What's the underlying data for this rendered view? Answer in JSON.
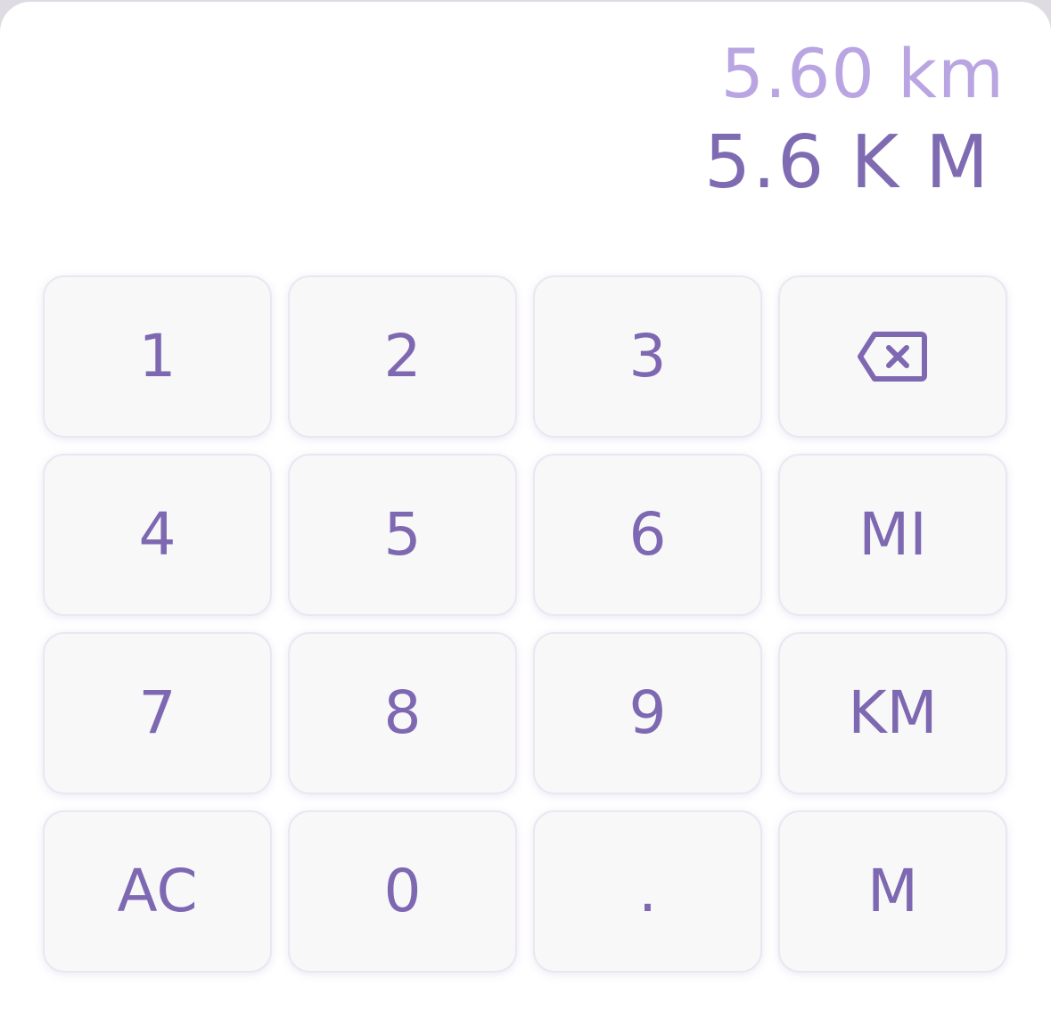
{
  "display": {
    "result": "5.60 km",
    "input": "5.6 K M"
  },
  "keypad": {
    "keys": [
      {
        "label": "1"
      },
      {
        "label": "2"
      },
      {
        "label": "3"
      },
      {
        "icon": "backspace-icon"
      },
      {
        "label": "4"
      },
      {
        "label": "5"
      },
      {
        "label": "6"
      },
      {
        "label": "MI"
      },
      {
        "label": "7"
      },
      {
        "label": "8"
      },
      {
        "label": "9"
      },
      {
        "label": "KM"
      },
      {
        "label": "AC"
      },
      {
        "label": "0"
      },
      {
        "label": "."
      },
      {
        "label": "M"
      }
    ]
  },
  "colors": {
    "accent": "#7d68b1",
    "result_text": "#b9a5e2",
    "key_background": "#f8f8f9",
    "page_background": "#ffffff"
  }
}
